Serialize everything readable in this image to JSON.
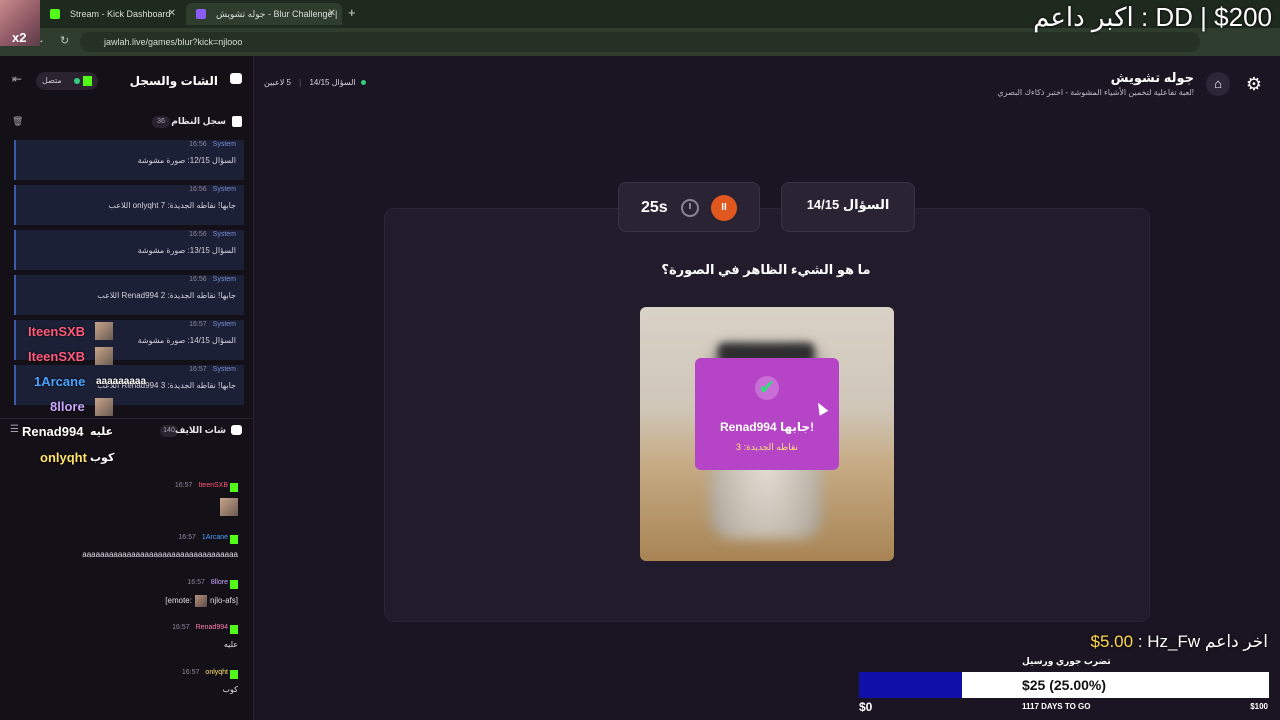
{
  "browser": {
    "tabs": [
      {
        "title": "Stream - Kick Dashboard",
        "close": "✕"
      },
      {
        "title": "جوله تشويش - Blur Challenge |",
        "close": "✕"
      }
    ],
    "new_tab": "+",
    "url": "jawlah.live/games/blur?kick=njlooo",
    "back": "←",
    "forward": "→",
    "reload": "↻"
  },
  "overlay": {
    "multiplier": "x2",
    "top_donor": "اكبر داعم : DD | $200",
    "last_donor_label": "اخر داعم",
    "last_donor_name": "Hz_Fw",
    "last_donor_amount": "$5.00",
    "goal": {
      "title": "تضرب جوري ورسيل",
      "progress_text": "$25 (25.00%)",
      "fraction": 0.25,
      "min": "$0",
      "max": "$100",
      "days": "1117 DAYS TO GO",
      "fill_color": "#1010a8"
    }
  },
  "left_panel": {
    "title": "الشات والسجل",
    "status": "متصل",
    "system_log": {
      "title": "سجل النظام",
      "count": "36",
      "entries": [
        {
          "time": "16:56",
          "source": "System",
          "text": "السؤال 12/15: صورة مشوشة"
        },
        {
          "time": "16:56",
          "source": "System",
          "text": "اللاعب onlyqht جابها! نقاطه الجديدة: 7"
        },
        {
          "time": "16:56",
          "source": "System",
          "text": "السؤال 13/15: صورة مشوشة"
        },
        {
          "time": "16:56",
          "source": "System",
          "text": "اللاعب Renad994 جابها! نقاطه الجديدة: 2"
        },
        {
          "time": "16:57",
          "source": "System",
          "text": "السؤال 14/15: صورة مشوشة"
        },
        {
          "time": "16:57",
          "source": "System",
          "text": "اللاعب Renad994 جابها! نقاطه الجديدة: 3"
        }
      ]
    },
    "overlay_chat": [
      {
        "name": "IteenSXB",
        "color": "#ff5a7a"
      },
      {
        "name": "IteenSXB",
        "color": "#ff5a7a"
      },
      {
        "name": "1Arcane",
        "color": "#4aa3ff",
        "text": "aaaaaaaaa"
      },
      {
        "name": "8llore",
        "color": "#c7a6ff"
      },
      {
        "name": "Renad994",
        "color": "#ffffff",
        "text": "عليه"
      },
      {
        "name": "onlyqht",
        "color": "#ffe26a",
        "text": "كوب"
      }
    ],
    "live_chat": {
      "title": "شات اللايف",
      "count": "140",
      "messages": [
        {
          "time": "16:57",
          "user": "IteenSXB",
          "color": "#ff5a7a",
          "text": ""
        },
        {
          "time": "16:57",
          "user": "1Arcane",
          "color": "#4aa3ff",
          "text": "aaaaaaaaaaaaaaaaaaaaaaaaaaaaaaaaaaa"
        },
        {
          "time": "16:57",
          "user": "8llore",
          "color": "#c7a6ff",
          "text_pre": "[emote:",
          "text_post": "njlo-afs]"
        },
        {
          "time": "16:57",
          "user": "Renad994",
          "color": "#ff7eb3",
          "text": "عليه"
        },
        {
          "time": "16:57",
          "user": "onlyqht",
          "color": "#ffe26a",
          "text": "كوب"
        }
      ]
    }
  },
  "main": {
    "title": "جوله تشويش",
    "subtitle": "لعبة تفاعلية لتخمين الأشياء المشوشة - اختبر ذكاءك البصري!",
    "players": "5 لاعبين",
    "question_counter_top": "السؤال 14/15",
    "timer": "25s",
    "pause_glyph": "II",
    "question_label": "السؤال 14/15",
    "question": "ما هو الشيء الظاهر في الصورة؟",
    "answer": {
      "check": "✔",
      "winner": "Renad994 جابها!",
      "points": "نقاطه الجديدة: 3"
    },
    "home_icon": "⌂",
    "gear_icon": "⚙"
  }
}
